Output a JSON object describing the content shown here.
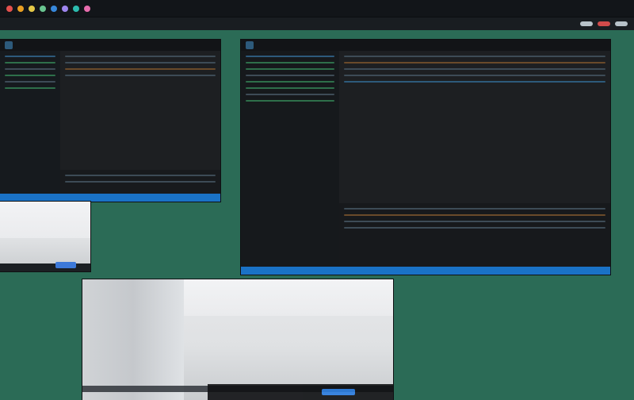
{
  "topbar": {
    "app_dots": [
      {
        "name": "red",
        "color": "#ef5350"
      },
      {
        "name": "orange",
        "color": "#f6a623"
      },
      {
        "name": "yellow",
        "color": "#f1d34a"
      },
      {
        "name": "green",
        "color": "#6fcf97"
      },
      {
        "name": "blue",
        "color": "#3a8ee6"
      },
      {
        "name": "purple",
        "color": "#a78bfa"
      },
      {
        "name": "teal",
        "color": "#2ec4b6"
      },
      {
        "name": "pink",
        "color": "#f472b6"
      }
    ]
  },
  "toolbar": {
    "menus": [],
    "right_pills": [
      {
        "color": "#b8c2c9"
      },
      {
        "color": "#d14b4b"
      },
      {
        "color": "#b8c2c9"
      }
    ]
  },
  "windows": {
    "left_editor": {
      "title": "",
      "status_text": ""
    },
    "right_editor": {
      "title": "",
      "tabs": [],
      "status_text": ""
    }
  },
  "colors": {
    "desktop_bg": "#2b6b56",
    "statusbar_blue": "#1a72c6"
  }
}
